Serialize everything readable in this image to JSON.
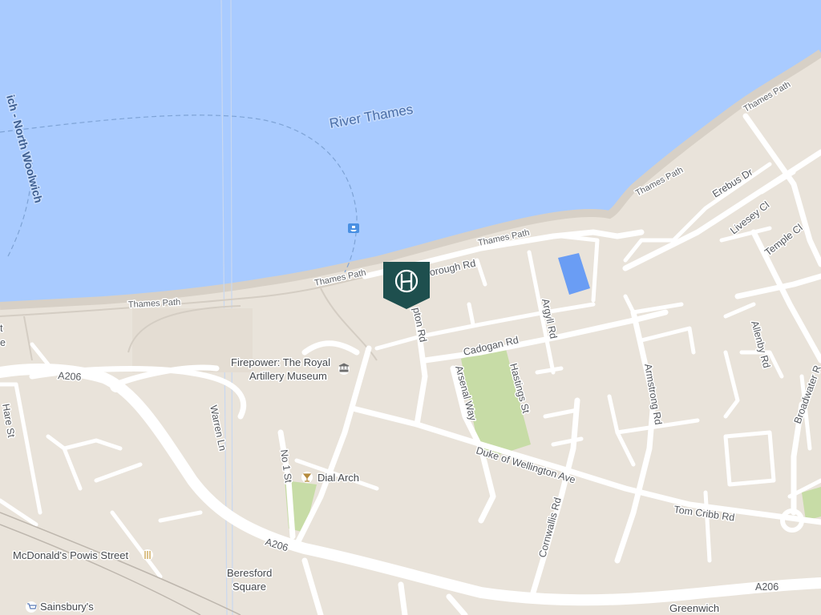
{
  "map": {
    "water": {
      "name": "River Thames",
      "color": "#a9cbff"
    },
    "ferry": {
      "name": "ich - North Woolwich"
    },
    "land_color": "#e9e3da",
    "park_color": "#c7dca6",
    "pool_color": "#6a9df4",
    "marker": {
      "name": "hotel-marker",
      "color": "#1e4f4e"
    },
    "streets": {
      "a206_west": "A206",
      "a206_mid": "A206",
      "a206_east": "A206",
      "thames_path_1": "Thames Path",
      "thames_path_2": "Thames Path",
      "thames_path_3": "Thames Path",
      "thames_path_4": "Thames Path",
      "thames_path_5": "Thames Path",
      "borough_rd": "borough Rd",
      "pton_rd": "pton Rd",
      "cadogan_rd": "Cadogan Rd",
      "argyll_rd": "Argyll Rd",
      "arsenal_way": "Arsenal Way",
      "hastings_st": "Hastings St",
      "armstrong_rd": "Armstrong Rd",
      "duke_wellington": "Duke of Wellington Ave",
      "tom_cribb": "Tom Cribb Rd",
      "cornwallis_rd": "Cornwallis Rd",
      "warren_ln": "Warren Ln",
      "no1_st": "No 1 St",
      "hare_st": "Hare St",
      "erebus_dr": "Erebus Dr",
      "livesey_cl": "Livesey Cl",
      "temple_cl": "Temple Cl",
      "allenby_rd": "Allenby Rd",
      "broadwater_r": "Broadwater R",
      "edge_t": "t",
      "edge_e": "e"
    },
    "pois": {
      "firepower_line1": "Firepower: The Royal",
      "firepower_line2": "Artillery Museum",
      "dial_arch": "Dial Arch",
      "mcdonalds": "McDonald's Powis Street",
      "beresford_line1": "Beresford",
      "beresford_line2": "Square",
      "sainsburys": "Sainsbury's",
      "greenwich": "Greenwich"
    }
  }
}
